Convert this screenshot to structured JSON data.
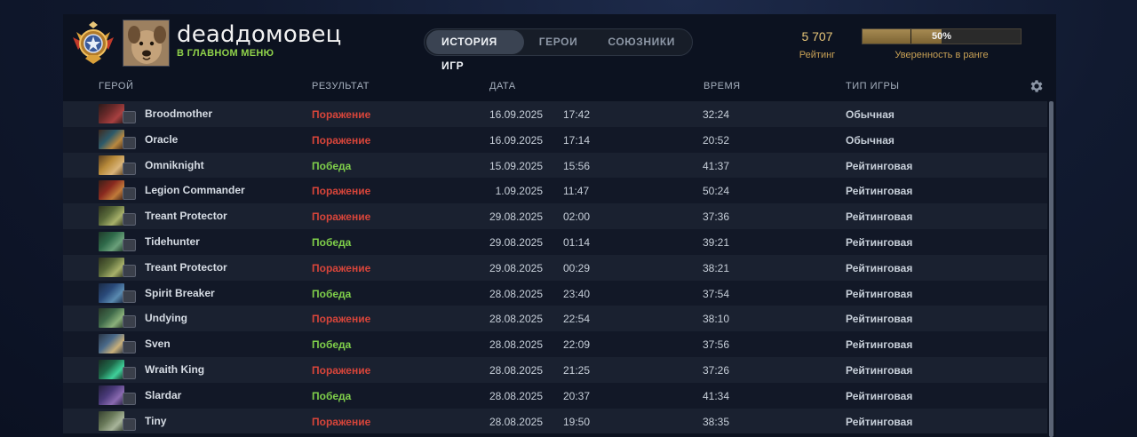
{
  "header": {
    "username": "deadдомовец",
    "status": "В ГЛАВНОМ МЕНЮ",
    "tabs": [
      {
        "label": "ИСТОРИЯ ИГР",
        "active": true
      },
      {
        "label": "ГЕРОИ",
        "active": false
      },
      {
        "label": "СОЮЗНИКИ",
        "active": false
      }
    ],
    "rating_value": "5 707",
    "rating_label": "Рейтинг",
    "confidence_percent": 50,
    "confidence_text": "50%",
    "confidence_label": "Уверенность в ранге"
  },
  "columns": {
    "hero": "ГЕРОЙ",
    "result": "РЕЗУЛЬТАТ",
    "date": "ДАТА",
    "duration": "ВРЕМЯ",
    "game_type": "ТИП ИГРЫ"
  },
  "colors": {
    "loss": "#d8453a",
    "win": "#7fcf4a",
    "status_green": "#8fd14a",
    "gold": "#e8c679"
  },
  "matches": [
    {
      "hero": "Broodmother",
      "result": "Поражение",
      "win": false,
      "date": "16.09.2025",
      "time": "17:42",
      "duration": "32:24",
      "type": "Обычная",
      "portrait": [
        "#6b2a2a",
        "#a84040",
        "#2b1a1a"
      ]
    },
    {
      "hero": "Oracle",
      "result": "Поражение",
      "win": false,
      "date": "16.09.2025",
      "time": "17:14",
      "duration": "20:52",
      "type": "Обычная",
      "portrait": [
        "#2d5a6a",
        "#b9883f",
        "#3f2a20"
      ]
    },
    {
      "hero": "Omniknight",
      "result": "Победа",
      "win": true,
      "date": "15.09.2025",
      "time": "15:56",
      "duration": "41:37",
      "type": "Рейтинговая",
      "portrait": [
        "#b98b3a",
        "#d9b47a",
        "#5a3f20"
      ]
    },
    {
      "hero": "Legion Commander",
      "result": "Поражение",
      "win": false,
      "date": "1.09.2025",
      "time": "11:47",
      "duration": "50:24",
      "type": "Рейтинговая",
      "portrait": [
        "#8a2a1f",
        "#c07a3a",
        "#3a1f18"
      ]
    },
    {
      "hero": "Treant Protector",
      "result": "Поражение",
      "win": false,
      "date": "29.08.2025",
      "time": "02:00",
      "duration": "37:36",
      "type": "Рейтинговая",
      "portrait": [
        "#5a6a3a",
        "#a7b06a",
        "#2f3520"
      ]
    },
    {
      "hero": "Tidehunter",
      "result": "Победа",
      "win": true,
      "date": "29.08.2025",
      "time": "01:14",
      "duration": "39:21",
      "type": "Рейтинговая",
      "portrait": [
        "#2f6a4a",
        "#6aa07a",
        "#1f3a2a"
      ]
    },
    {
      "hero": "Treant Protector",
      "result": "Поражение",
      "win": false,
      "date": "29.08.2025",
      "time": "00:29",
      "duration": "38:21",
      "type": "Рейтинговая",
      "portrait": [
        "#5a6a3a",
        "#a7b06a",
        "#2f3520"
      ]
    },
    {
      "hero": "Spirit Breaker",
      "result": "Победа",
      "win": true,
      "date": "28.08.2025",
      "time": "23:40",
      "duration": "37:54",
      "type": "Рейтинговая",
      "portrait": [
        "#2a4a7a",
        "#5a8ab0",
        "#1a2a45"
      ]
    },
    {
      "hero": "Undying",
      "result": "Поражение",
      "win": false,
      "date": "28.08.2025",
      "time": "22:54",
      "duration": "38:10",
      "type": "Рейтинговая",
      "portrait": [
        "#3f6a4a",
        "#8ab07a",
        "#2a3a2a"
      ]
    },
    {
      "hero": "Sven",
      "result": "Победа",
      "win": true,
      "date": "28.08.2025",
      "time": "22:09",
      "duration": "37:56",
      "type": "Рейтинговая",
      "portrait": [
        "#4a6a8a",
        "#c9b07a",
        "#2a3545"
      ]
    },
    {
      "hero": "Wraith King",
      "result": "Поражение",
      "win": false,
      "date": "28.08.2025",
      "time": "21:25",
      "duration": "37:26",
      "type": "Рейтинговая",
      "portrait": [
        "#1f6a4a",
        "#3fd09a",
        "#1a2f25"
      ]
    },
    {
      "hero": "Slardar",
      "result": "Победа",
      "win": true,
      "date": "28.08.2025",
      "time": "20:37",
      "duration": "41:34",
      "type": "Рейтинговая",
      "portrait": [
        "#4a3a7a",
        "#8a6ab0",
        "#25203f"
      ]
    },
    {
      "hero": "Tiny",
      "result": "Поражение",
      "win": false,
      "date": "28.08.2025",
      "time": "19:50",
      "duration": "38:35",
      "type": "Рейтинговая",
      "portrait": [
        "#6a7a5a",
        "#a8b59a",
        "#35402f"
      ]
    }
  ]
}
